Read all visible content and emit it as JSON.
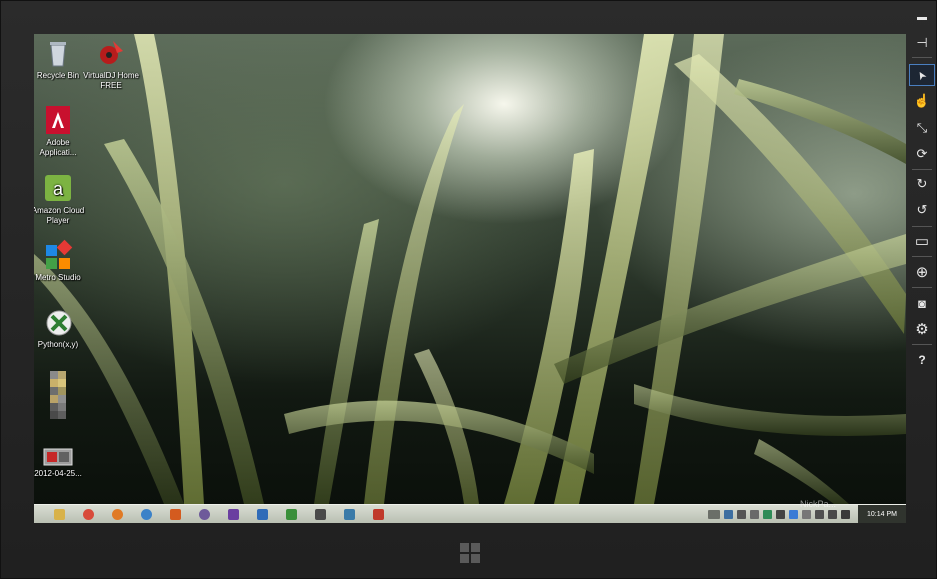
{
  "desktop": {
    "icons": [
      {
        "label": "Recycle Bin",
        "icon": "recycle-bin-icon"
      },
      {
        "label": "VirtualDJ Home FREE",
        "icon": "virtualdj-icon"
      },
      {
        "label": "Adobe Applicati...",
        "icon": "adobe-icon"
      },
      {
        "label": "Amazon Cloud Player",
        "icon": "amazon-icon"
      },
      {
        "label": "Metro Studio",
        "icon": "metro-studio-icon"
      },
      {
        "label": "Python(x,y)",
        "icon": "python-xy-icon"
      },
      {
        "label": "",
        "icon": "blurred-file-icon"
      },
      {
        "label": "2012-04-25...",
        "icon": "image-file-icon"
      }
    ]
  },
  "taskbar": {
    "apps": [
      {
        "name": "file-explorer-icon",
        "color": "#d8b24a"
      },
      {
        "name": "chrome-icon",
        "color": "#d84a3a"
      },
      {
        "name": "firefox-icon",
        "color": "#e07a25"
      },
      {
        "name": "internet-explorer-icon",
        "color": "#3c82c8"
      },
      {
        "name": "matlab-icon",
        "color": "#d45b1f"
      },
      {
        "name": "app-icon-6",
        "color": "#6e5a9a"
      },
      {
        "name": "visual-studio-icon",
        "color": "#6a3fa0"
      },
      {
        "name": "app-icon-8",
        "color": "#2f6bb8"
      },
      {
        "name": "app-icon-9",
        "color": "#3a8f3a"
      },
      {
        "name": "app-icon-10",
        "color": "#4a4a4a"
      },
      {
        "name": "app-icon-11",
        "color": "#3a7aa8"
      },
      {
        "name": "app-icon-12",
        "color": "#c0392b"
      }
    ],
    "tray_watermark": "NickPa...",
    "clock": "10:14 PM"
  },
  "toolbar": {
    "items": [
      {
        "name": "minimize-icon",
        "glyph": "▬"
      },
      {
        "name": "pin-icon",
        "glyph": "⊣"
      },
      {
        "name": "pointer-icon",
        "glyph": "➤"
      },
      {
        "name": "touch-icon",
        "glyph": "☝"
      },
      {
        "name": "pinch-icon",
        "glyph": "⤡"
      },
      {
        "name": "rotate-gesture-icon",
        "glyph": "⟳"
      },
      {
        "name": "rotate-clockwise-icon",
        "glyph": "↻"
      },
      {
        "name": "rotate-counterclockwise-icon",
        "glyph": "↺"
      },
      {
        "name": "resolution-icon",
        "glyph": "▭"
      },
      {
        "name": "location-icon",
        "glyph": "⊕"
      },
      {
        "name": "camera-icon",
        "glyph": "◙"
      },
      {
        "name": "settings-icon",
        "glyph": "⚙"
      },
      {
        "name": "help-icon",
        "glyph": "?"
      }
    ]
  },
  "colors": {
    "accent": "#4a7fc0",
    "frame": "#262626"
  }
}
